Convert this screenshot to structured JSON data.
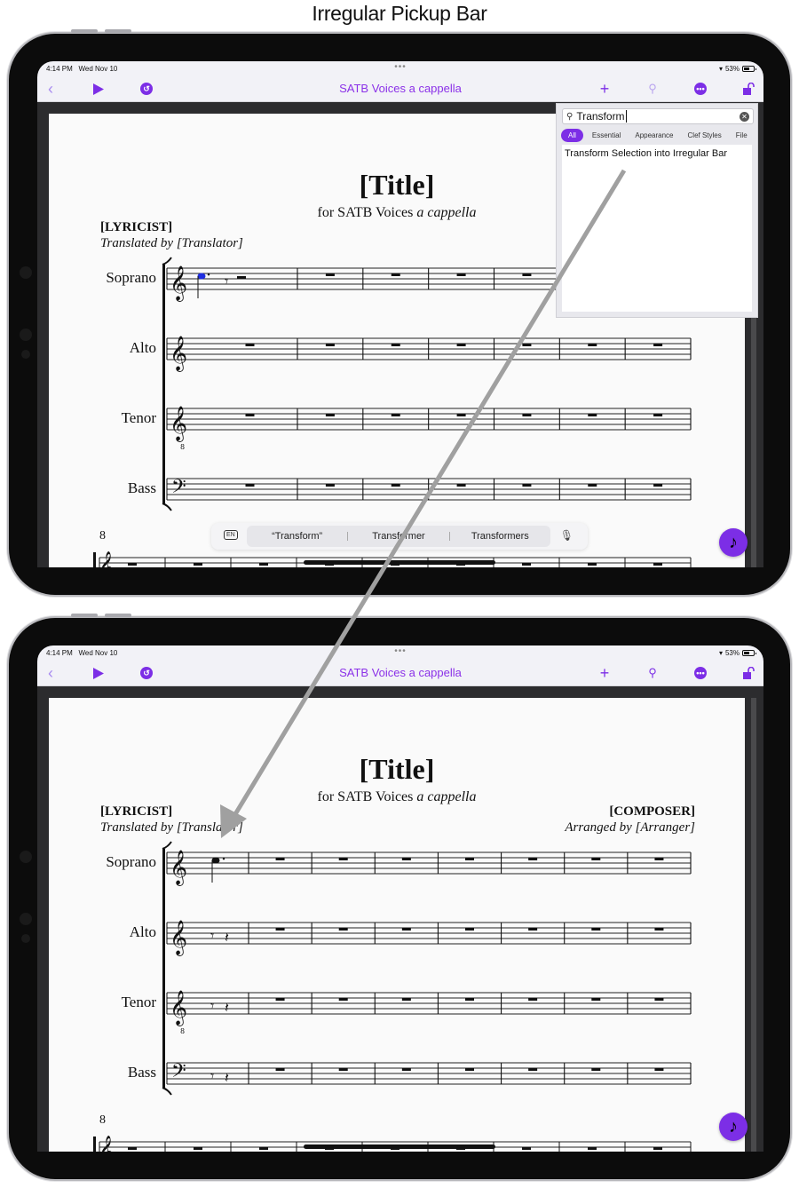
{
  "caption": "Irregular Pickup Bar",
  "colors": {
    "accent": "#7c2ee6",
    "selected_note": "#1f2ee0",
    "arrow": "#a0a0a0"
  },
  "screens": [
    {
      "status": {
        "time": "4:14 PM",
        "date": "Wed Nov 10",
        "battery": "53%",
        "dots": "•••"
      },
      "nav": {
        "title": "SATB Voices a cappella",
        "back_icon": "chevron-left-icon",
        "play_icon": "play-icon",
        "undo_icon": "undo-icon",
        "add_icon": "plus-icon",
        "search_icon": "search-icon",
        "more_icon": "ellipsis-circle-icon",
        "lock_icon": "unlock-icon"
      },
      "score": {
        "title": "[Title]",
        "subtitle_roman": "for SATB Voices ",
        "subtitle_italic": "a cappella",
        "lyricist": "[LYRICIST]",
        "translator": "Translated by [Translator]",
        "staves": [
          {
            "name": "Soprano",
            "clef": "treble"
          },
          {
            "name": "Alto",
            "clef": "treble"
          },
          {
            "name": "Tenor",
            "clef": "treble-8vb"
          },
          {
            "name": "Bass",
            "clef": "bass"
          }
        ],
        "next_system_measure": "8"
      },
      "search": {
        "value": "Transform",
        "filters": [
          "All",
          "Essential",
          "Appearance",
          "Clef Styles",
          "File"
        ],
        "active_filter": "All",
        "results": [
          "Transform Selection into Irregular Bar"
        ]
      },
      "keyboard_suggestions": {
        "lang": "EN",
        "words": [
          "“Transform”",
          "Transformer",
          "Transformers"
        ]
      },
      "fab_icon": "♪"
    },
    {
      "status": {
        "time": "4:14 PM",
        "date": "Wed Nov 10",
        "battery": "53%",
        "dots": "•••"
      },
      "nav": {
        "title": "SATB Voices a cappella"
      },
      "score": {
        "title": "[Title]",
        "subtitle_roman": "for SATB Voices ",
        "subtitle_italic": "a cappella",
        "lyricist": "[LYRICIST]",
        "translator": "Translated by [Translator]",
        "composer": "[COMPOSER]",
        "arranger": "Arranged by [Arranger]",
        "staves": [
          {
            "name": "Soprano",
            "clef": "treble"
          },
          {
            "name": "Alto",
            "clef": "treble"
          },
          {
            "name": "Tenor",
            "clef": "treble-8vb"
          },
          {
            "name": "Bass",
            "clef": "bass"
          }
        ],
        "next_system_measure": "8"
      },
      "fab_icon": "♪"
    }
  ]
}
